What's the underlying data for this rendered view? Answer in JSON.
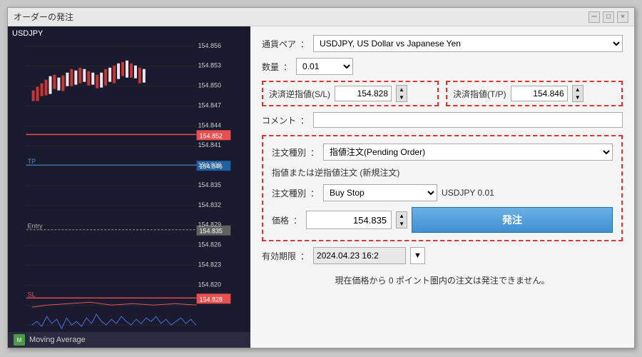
{
  "window": {
    "title": "オーダーの発注",
    "controls": {
      "minimize": "─",
      "maximize": "□",
      "close": "×"
    }
  },
  "chart": {
    "symbol": "USDJPY",
    "prices": {
      "p1": "154.856",
      "p2": "154.853",
      "p3": "154.852",
      "p4": "154.850",
      "p5": "154.847",
      "p6": "154.846",
      "p7": "154.844",
      "p8": "154.841",
      "p9": "154.838",
      "p10": "154.835",
      "p11": "154.832",
      "p12": "154.829",
      "p13": "154.828",
      "p14": "154.826",
      "p15": "154.823",
      "p16": "154.820"
    },
    "labels": {
      "tp": "TP",
      "entry": "Entry",
      "sl": "SL"
    }
  },
  "form": {
    "pair_label": "通貨ペア",
    "pair_value": "USDJPY, US Dollar vs Japanese Yen",
    "qty_label": "数量",
    "qty_value": "0.01",
    "sl_label": "決済逆指値(S/L)",
    "sl_value": "154.828",
    "tp_label": "決済指値(T/P)",
    "tp_value": "154.846",
    "comment_label": "コメント",
    "order_type_label": "注文種別",
    "order_type_value": "指値注文(Pending Order)",
    "pending_subtitle": "指値または逆指値注文 (新規注文)",
    "order_sub_label": "注文種別",
    "order_sub_value": "Buy Stop",
    "order_qty_display": "USDJPY 0.01",
    "price_label": "価格",
    "price_value": "154.835",
    "place_order_btn": "発注",
    "expiry_label": "有効期限",
    "expiry_value": "2024.04.23 16:2",
    "warning": "現在価格から 0 ポイント圏内の注文は発注できません。"
  },
  "bottom_bar": {
    "ma_label": "Moving Average"
  }
}
